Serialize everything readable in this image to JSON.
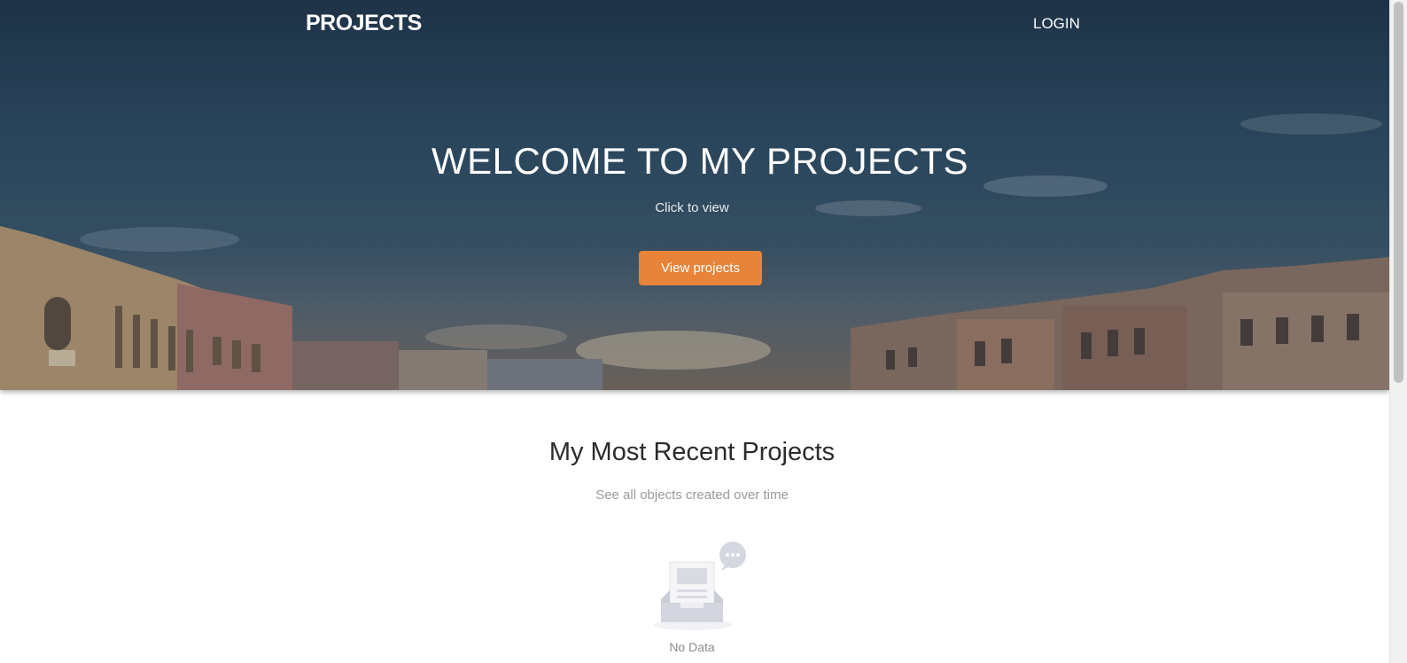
{
  "colors": {
    "accent": "#e8843a",
    "hero_overlay": "#2d4a60",
    "text_dark": "#2b2b2b",
    "text_muted": "#9a9a9a"
  },
  "navbar": {
    "brand": "PROJECTS",
    "login_label": "LOGIN"
  },
  "hero": {
    "title": "WELCOME TO MY PROJECTS",
    "subtitle": "Click to view",
    "cta_label": "View projects",
    "background": "city-skyline-dusk"
  },
  "recent": {
    "title": "My Most Recent Projects",
    "subtitle": "See all objects created over time",
    "empty_icon": "empty-inbox-icon",
    "empty_text": "No Data"
  }
}
